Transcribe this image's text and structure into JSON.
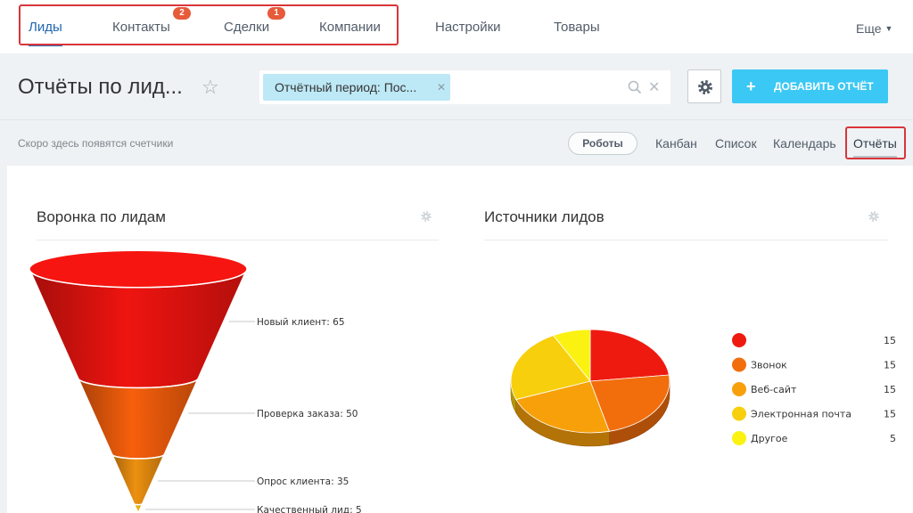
{
  "nav": {
    "items": [
      {
        "label": "Лиды"
      },
      {
        "label": "Контакты",
        "badge": "2"
      },
      {
        "label": "Сделки",
        "badge": "1"
      },
      {
        "label": "Компании"
      },
      {
        "label": "Настройки"
      },
      {
        "label": "Товары"
      }
    ],
    "more": "Еще"
  },
  "header": {
    "title": "Отчёты по лид...",
    "filter_chip": "Отчётный период: Пос...",
    "add_button": "ДОБАВИТЬ ОТЧЁТ"
  },
  "toolbar": {
    "counters_note": "Скоро здесь появятся счетчики",
    "robots": "Роботы",
    "views": [
      "Канбан",
      "Список",
      "Календарь",
      "Отчёты"
    ],
    "active_view": "Отчёты"
  },
  "colors": {
    "accent": "#3bc8f5",
    "link": "#2067b0",
    "highlight": "#d9353a"
  },
  "icons": [
    "star-icon",
    "search-icon",
    "close-icon",
    "gear-icon",
    "plus-icon"
  ],
  "chart_data": [
    {
      "type": "funnel",
      "title": "Воронка по лидам",
      "stages": [
        {
          "label": "Новый клиент",
          "value": 65,
          "color": "#e4130f"
        },
        {
          "label": "Проверка заказа",
          "value": 50,
          "color": "#ea5a0b"
        },
        {
          "label": "Опрос клиента",
          "value": 35,
          "color": "#e2890f"
        },
        {
          "label": "Качественный лид",
          "value": 5,
          "color": "#e6b10b"
        }
      ]
    },
    {
      "type": "pie",
      "title": "Источники лидов",
      "legend_position": "right",
      "slices": [
        {
          "label": "",
          "value": 15,
          "color": "#ee1a10"
        },
        {
          "label": "Звонок",
          "value": 15,
          "color": "#f26e0c"
        },
        {
          "label": "Веб-сайт",
          "value": 15,
          "color": "#f8a00a"
        },
        {
          "label": "Электронная почта",
          "value": 15,
          "color": "#f8cf0c"
        },
        {
          "label": "Другое",
          "value": 5,
          "color": "#fbf212"
        }
      ]
    }
  ]
}
